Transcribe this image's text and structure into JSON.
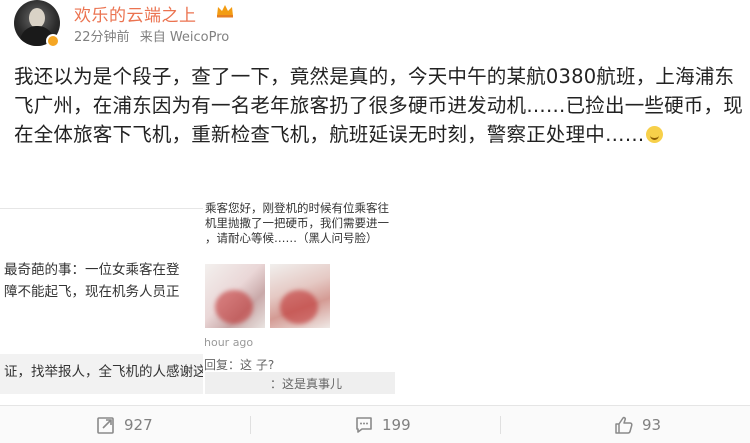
{
  "header": {
    "username": "欢乐的云端之上",
    "time_ago": "22分钟前",
    "source": "来自 WeicoPro"
  },
  "post": {
    "text": "我还以为是个段子，查了一下，竟然是真的，今天中午的某航0380航班，上海浦东飞广州，在浦东因为有一名老年旅客扔了很多硬币进发动机……已捡出一些硬币，现在全体旅客下飞机，重新检查飞机，航班延误无时刻，警察正处理中……",
    "emoji": "tired-face-emoji"
  },
  "screenshot_left": {
    "line1": "最奇葩的事：一位女乘客在登",
    "line2": "障不能起飞，现在机务人员正",
    "line3": "证，找举报人，全飞机的人感谢这"
  },
  "screenshot_overlay": {
    "line1": "乘客您好，刚登机的时候有位乘客往",
    "line2": "机里抛撒了一把硬币，我们需要进一",
    "line3": "，请耐心等候……（黑人问号脸）",
    "hours_ago": "hour ago",
    "reply1": "回复：这    子?",
    "reply2": "：这是真事儿"
  },
  "actions": {
    "repost_count": "927",
    "comment_count": "199",
    "like_count": "93"
  },
  "colors": {
    "username": "#eb7350",
    "meta": "#808080",
    "text": "#222222"
  }
}
